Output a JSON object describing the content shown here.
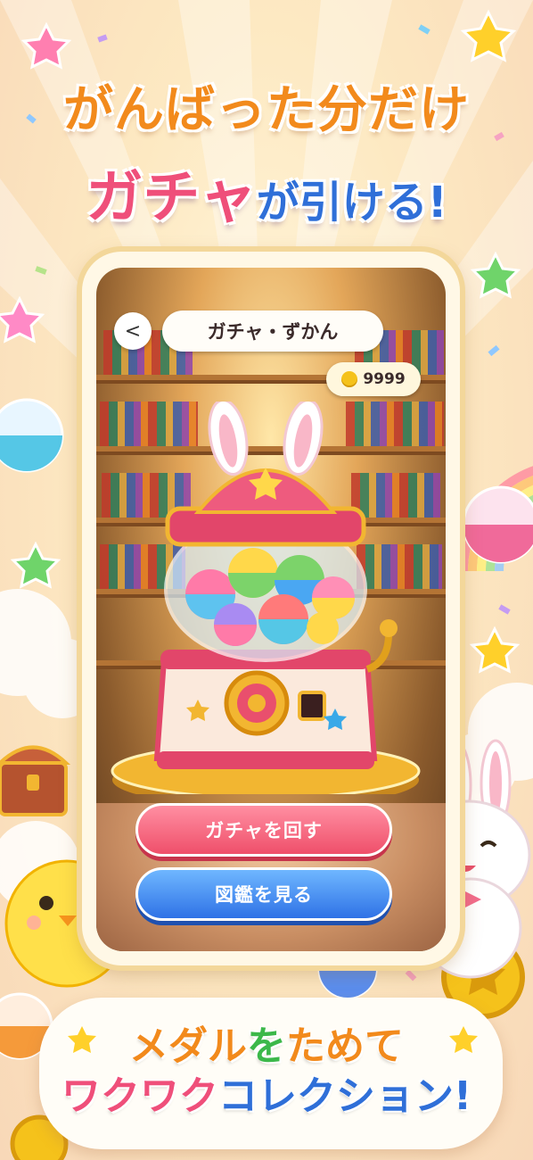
{
  "headline": {
    "line1": "がんばった分だけ",
    "line2_pink": "ガチャ",
    "line2_blue": "が引ける!"
  },
  "app": {
    "back_label": "<",
    "title": "ガチャ・ずかん",
    "coins": "9999",
    "buttons": {
      "spin": "ガチャを回す",
      "encyclopedia": "図鑑を見る"
    }
  },
  "banner": {
    "line1_a": "メダル",
    "line1_b": "を",
    "line1_c": "ためて",
    "line2_a": "ワクワク",
    "line2_b": "コレクション!"
  },
  "colors": {
    "orange": "#f28a1c",
    "pink": "#ef4f7a",
    "blue": "#2f6fd8",
    "green": "#3cb84a",
    "gold": "#f5c21b"
  }
}
